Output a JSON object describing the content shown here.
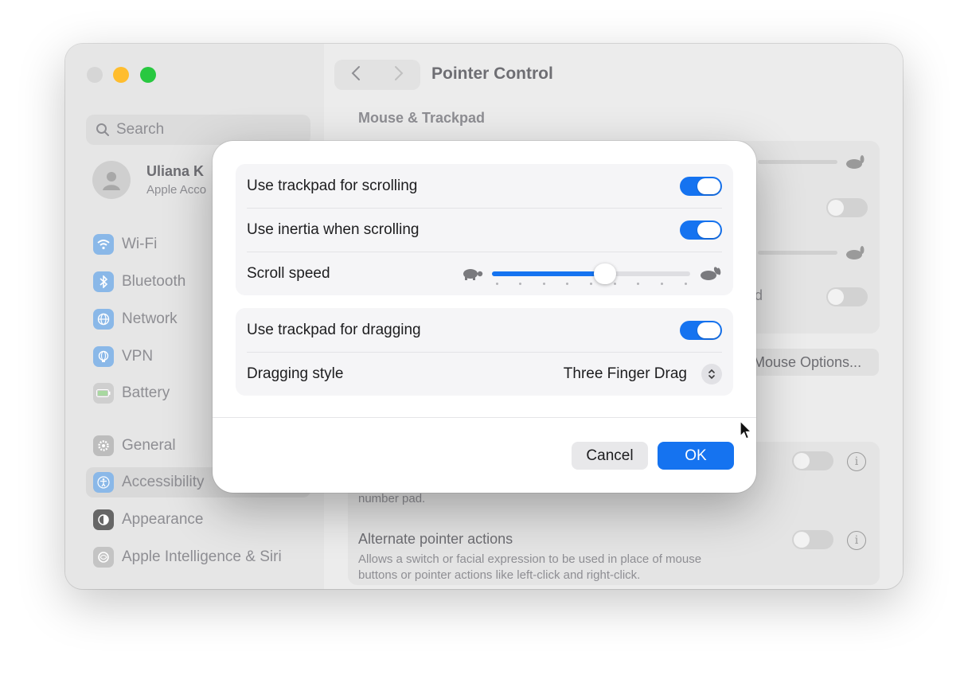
{
  "window": {
    "title": "Pointer Control"
  },
  "sidebar": {
    "search_placeholder": "Search",
    "account": {
      "name": "Uliana K",
      "subtitle": "Apple Acco"
    },
    "items": [
      {
        "label": "Wi-Fi",
        "icon": "wifi-icon",
        "color": "#8ab8e8"
      },
      {
        "label": "Bluetooth",
        "icon": "bluetooth-icon",
        "color": "#8ab8e8"
      },
      {
        "label": "Network",
        "icon": "network-icon",
        "color": "#8ab8e8"
      },
      {
        "label": "VPN",
        "icon": "vpn-icon",
        "color": "#8ab8e8"
      },
      {
        "label": "Battery",
        "icon": "battery-icon",
        "color": "#a8d8a0"
      },
      {
        "label": "General",
        "icon": "gear-icon",
        "color": "#b8b8b8"
      },
      {
        "label": "Accessibility",
        "icon": "accessibility-icon",
        "color": "#8ab8e8"
      },
      {
        "label": "Appearance",
        "icon": "appearance-icon",
        "color": "#666666"
      },
      {
        "label": "Apple Intelligence & Siri",
        "icon": "siri-icon",
        "color": "#b8b8b8"
      }
    ]
  },
  "main": {
    "section_title": "Mouse & Trackpad",
    "mouse_options_label": "Mouse Options...",
    "partial_label": "d",
    "partial_desc": "number pad.",
    "alt_title": "Alternate pointer actions",
    "alt_desc_line1": "Allows a switch or facial expression to be used in place of mouse",
    "alt_desc_line2": "buttons or pointer actions like left-click and right-click."
  },
  "dialog": {
    "rows": {
      "scroll_trackpad": {
        "label": "Use trackpad for scrolling",
        "on": true
      },
      "inertia": {
        "label": "Use inertia when scrolling",
        "on": true
      },
      "scroll_speed": {
        "label": "Scroll speed",
        "value": 0.57,
        "ticks": 9
      },
      "drag_trackpad": {
        "label": "Use trackpad for dragging",
        "on": true
      },
      "drag_style": {
        "label": "Dragging style",
        "value": "Three Finger Drag"
      }
    },
    "cancel_label": "Cancel",
    "ok_label": "OK",
    "accent": "#1573f0"
  }
}
